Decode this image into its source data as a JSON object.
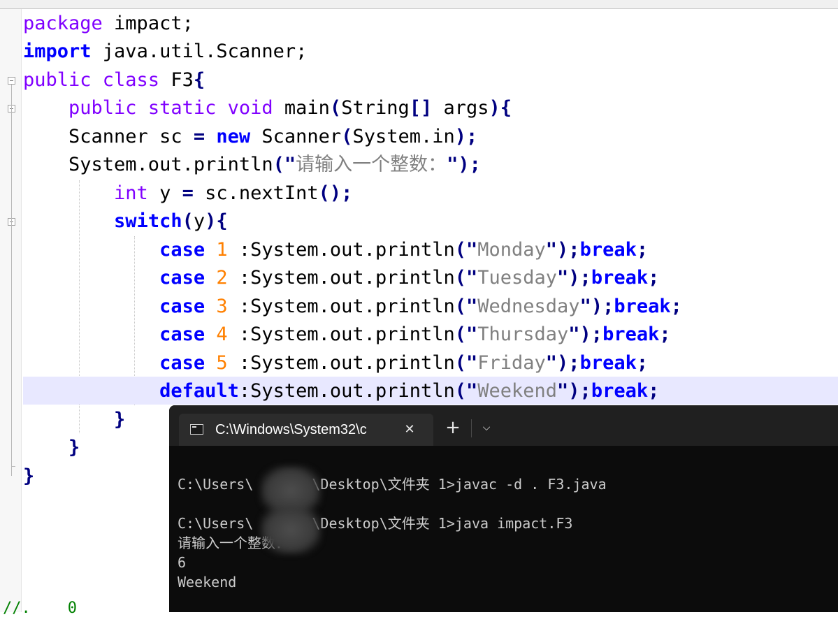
{
  "editor": {
    "code_lines": [
      {
        "id": "l1",
        "tokens": [
          {
            "t": "package ",
            "c": "kw"
          },
          {
            "t": "impact;",
            "c": "pl"
          }
        ]
      },
      {
        "id": "l2",
        "tokens": [
          {
            "t": "import ",
            "c": "kwb"
          },
          {
            "t": "java.util.Scanner;",
            "c": "pl"
          }
        ]
      },
      {
        "id": "l3",
        "tokens": [
          {
            "t": "public class ",
            "c": "kw"
          },
          {
            "t": "F3",
            "c": "pl"
          },
          {
            "t": "{",
            "c": "op"
          }
        ]
      },
      {
        "id": "l4",
        "tokens": [
          {
            "t": "    ",
            "c": "pl"
          },
          {
            "t": "public static void ",
            "c": "kw"
          },
          {
            "t": "main",
            "c": "pl"
          },
          {
            "t": "(",
            "c": "op"
          },
          {
            "t": "String",
            "c": "pl"
          },
          {
            "t": "[] ",
            "c": "op"
          },
          {
            "t": "args",
            "c": "pl"
          },
          {
            "t": "){",
            "c": "op"
          }
        ]
      },
      {
        "id": "l5",
        "tokens": [
          {
            "t": "    Scanner sc ",
            "c": "pl"
          },
          {
            "t": "= ",
            "c": "op"
          },
          {
            "t": "new ",
            "c": "kwb"
          },
          {
            "t": "Scanner",
            "c": "pl"
          },
          {
            "t": "(",
            "c": "op"
          },
          {
            "t": "System.in",
            "c": "pl"
          },
          {
            "t": ");",
            "c": "op"
          }
        ]
      },
      {
        "id": "l6",
        "tokens": [
          {
            "t": "    System.out.println",
            "c": "pl"
          },
          {
            "t": "(\"",
            "c": "op"
          },
          {
            "t": "请输入一个整数：",
            "c": "str"
          },
          {
            "t": "\");",
            "c": "op"
          }
        ]
      },
      {
        "id": "l7",
        "tokens": [
          {
            "t": "        ",
            "c": "pl"
          },
          {
            "t": "int ",
            "c": "kw"
          },
          {
            "t": "y ",
            "c": "pl"
          },
          {
            "t": "= ",
            "c": "op"
          },
          {
            "t": "sc.nextInt",
            "c": "pl"
          },
          {
            "t": "();",
            "c": "op"
          }
        ]
      },
      {
        "id": "l8",
        "tokens": [
          {
            "t": "        ",
            "c": "pl"
          },
          {
            "t": "switch",
            "c": "kwb"
          },
          {
            "t": "(",
            "c": "op"
          },
          {
            "t": "y",
            "c": "pl"
          },
          {
            "t": "){",
            "c": "op"
          }
        ]
      },
      {
        "id": "l9",
        "tokens": [
          {
            "t": "            ",
            "c": "pl"
          },
          {
            "t": "case ",
            "c": "kwb"
          },
          {
            "t": "1 ",
            "c": "num"
          },
          {
            "t": ":System.out.println",
            "c": "pl"
          },
          {
            "t": "(\"",
            "c": "op"
          },
          {
            "t": "Monday",
            "c": "str"
          },
          {
            "t": "\");",
            "c": "op"
          },
          {
            "t": "break",
            "c": "kwb"
          },
          {
            "t": ";",
            "c": "op"
          }
        ]
      },
      {
        "id": "l10",
        "tokens": [
          {
            "t": "            ",
            "c": "pl"
          },
          {
            "t": "case ",
            "c": "kwb"
          },
          {
            "t": "2 ",
            "c": "num"
          },
          {
            "t": ":System.out.println",
            "c": "pl"
          },
          {
            "t": "(\"",
            "c": "op"
          },
          {
            "t": "Tuesday",
            "c": "str"
          },
          {
            "t": "\");",
            "c": "op"
          },
          {
            "t": "break",
            "c": "kwb"
          },
          {
            "t": ";",
            "c": "op"
          }
        ]
      },
      {
        "id": "l11",
        "tokens": [
          {
            "t": "            ",
            "c": "pl"
          },
          {
            "t": "case ",
            "c": "kwb"
          },
          {
            "t": "3 ",
            "c": "num"
          },
          {
            "t": ":System.out.println",
            "c": "pl"
          },
          {
            "t": "(\"",
            "c": "op"
          },
          {
            "t": "Wednesday",
            "c": "str"
          },
          {
            "t": "\");",
            "c": "op"
          },
          {
            "t": "break",
            "c": "kwb"
          },
          {
            "t": ";",
            "c": "op"
          }
        ]
      },
      {
        "id": "l12",
        "tokens": [
          {
            "t": "            ",
            "c": "pl"
          },
          {
            "t": "case ",
            "c": "kwb"
          },
          {
            "t": "4 ",
            "c": "num"
          },
          {
            "t": ":System.out.println",
            "c": "pl"
          },
          {
            "t": "(\"",
            "c": "op"
          },
          {
            "t": "Thursday",
            "c": "str"
          },
          {
            "t": "\");",
            "c": "op"
          },
          {
            "t": "break",
            "c": "kwb"
          },
          {
            "t": ";",
            "c": "op"
          }
        ]
      },
      {
        "id": "l13",
        "tokens": [
          {
            "t": "            ",
            "c": "pl"
          },
          {
            "t": "case ",
            "c": "kwb"
          },
          {
            "t": "5 ",
            "c": "num"
          },
          {
            "t": ":System.out.println",
            "c": "pl"
          },
          {
            "t": "(\"",
            "c": "op"
          },
          {
            "t": "Friday",
            "c": "str"
          },
          {
            "t": "\");",
            "c": "op"
          },
          {
            "t": "break",
            "c": "kwb"
          },
          {
            "t": ";",
            "c": "op"
          }
        ]
      },
      {
        "id": "l14",
        "tokens": [
          {
            "t": "            ",
            "c": "pl"
          },
          {
            "t": "default",
            "c": "kwb"
          },
          {
            "t": ":System.out.println",
            "c": "pl"
          },
          {
            "t": "(\"",
            "c": "op"
          },
          {
            "t": "Weekend",
            "c": "str"
          },
          {
            "t": "\");",
            "c": "op"
          },
          {
            "t": "break",
            "c": "kwb"
          },
          {
            "t": ";",
            "c": "op"
          }
        ]
      },
      {
        "id": "l15",
        "tokens": [
          {
            "t": "        ",
            "c": "pl"
          },
          {
            "t": "}",
            "c": "op"
          }
        ]
      },
      {
        "id": "l16",
        "tokens": [
          {
            "t": "    ",
            "c": "pl"
          },
          {
            "t": "}",
            "c": "op"
          }
        ]
      },
      {
        "id": "l17",
        "tokens": [
          {
            "t": "}",
            "c": "op"
          }
        ]
      }
    ],
    "bottom_fragment": "//.    0"
  },
  "terminal": {
    "tab_title": "C:\\Windows\\System32\\c",
    "close_glyph": "✕",
    "new_tab_glyph": "+",
    "dropdown_glyph": "⌵",
    "output_lines": [
      {
        "pre": "C:\\Users\\",
        "post": "\\Desktop\\文件夹 1>javac -d . F3.java"
      },
      {
        "pre": "",
        "post": ""
      },
      {
        "pre": "C:\\Users\\",
        "post": "\\Desktop\\文件夹 1>java impact.F3"
      },
      {
        "pre": "请输入一个整数：",
        "post": ""
      },
      {
        "pre": "6",
        "post": ""
      },
      {
        "pre": "Weekend",
        "post": ""
      }
    ]
  },
  "colors": {
    "keyword": "#8000ff",
    "keyword_bold": "#0000ff",
    "number": "#ff8000",
    "string": "#808080",
    "operator": "#000080",
    "current_line": "#e8e8ff",
    "terminal_bg": "#0c0c0c",
    "terminal_text": "#cccccc"
  }
}
